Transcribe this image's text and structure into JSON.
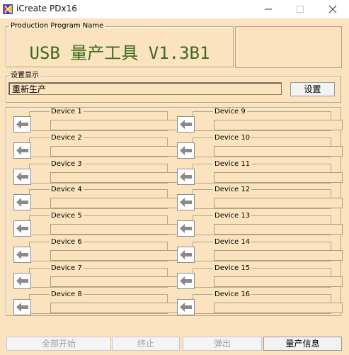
{
  "window": {
    "title": "iCreate PDx16"
  },
  "colors": {
    "window_bg": "#fbe3bf",
    "title_accent": "#3a6b1e"
  },
  "production": {
    "legend": "Production Program Name",
    "name": "USB 量产工具 V1.3B1"
  },
  "settings": {
    "legend": "设置显示",
    "display_value": "重新生产",
    "button_label": "设置"
  },
  "devices": [
    "Device 1",
    "Device 2",
    "Device 3",
    "Device 4",
    "Device 5",
    "Device 6",
    "Device 7",
    "Device 8",
    "Device 9",
    "Device 10",
    "Device 11",
    "Device 12",
    "Device 13",
    "Device 14",
    "Device 15",
    "Device 16"
  ],
  "footer": {
    "start_all": "全部开始",
    "stop": "终止",
    "eject": "弹出",
    "info": "量产信息"
  }
}
